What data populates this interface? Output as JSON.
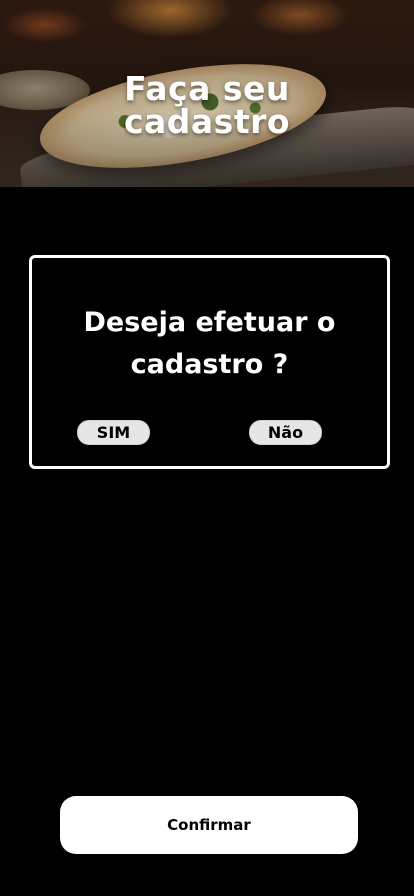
{
  "header": {
    "title_line1": "Faça seu",
    "title_line2": "cadastro"
  },
  "dialog": {
    "question_line1": "Deseja efetuar o",
    "question_line2": "cadastro ?",
    "yes_label": "SIM",
    "no_label": "Não"
  },
  "footer": {
    "confirm_label": "Confirmar"
  },
  "colors": {
    "background": "#000000",
    "dialog_border": "#ffffff",
    "choice_button": "#e6e6e9",
    "confirm_button": "#ffffff"
  }
}
